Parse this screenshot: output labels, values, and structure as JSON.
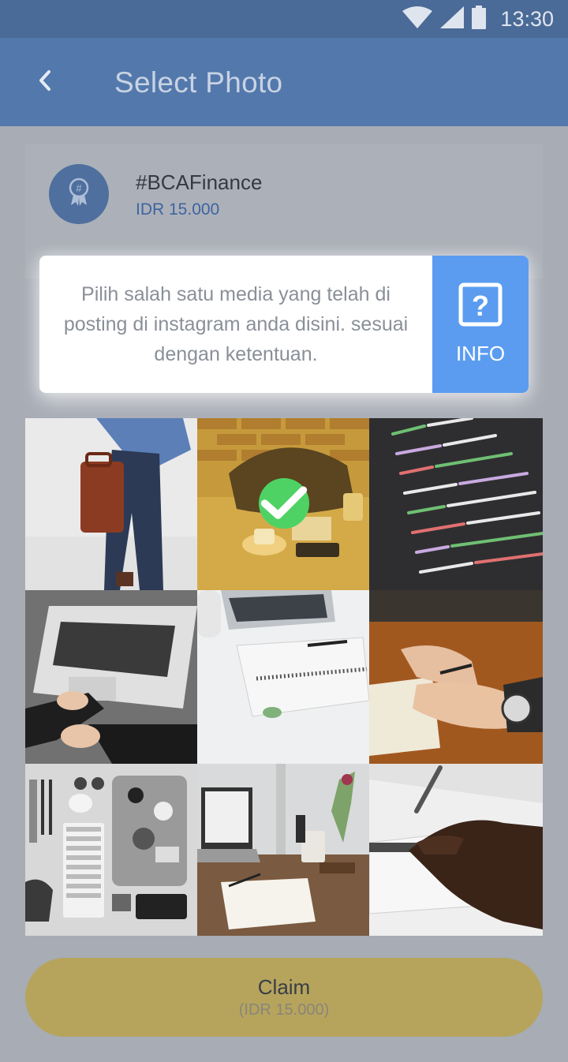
{
  "status_bar": {
    "time": "13:30",
    "icons": [
      "wifi-icon",
      "signal-icon",
      "battery-icon"
    ]
  },
  "header": {
    "title": "Select Photo",
    "back_icon": "chevron-left-icon"
  },
  "campaign": {
    "badge_icon": "hashtag-ribbon-icon",
    "hashtag": "#BCAFinance",
    "price": "IDR 15.000"
  },
  "info": {
    "text": "Pilih salah satu media yang telah di posting di instagram anda disini. sesuai dengan ketentuan.",
    "button_label": "INFO",
    "button_icon": "question-icon"
  },
  "photos": [
    {
      "id": "photo-1",
      "subject": "person-with-briefcase",
      "selected": false
    },
    {
      "id": "photo-2",
      "subject": "desk-with-bag-and-coffee",
      "selected": true
    },
    {
      "id": "photo-3",
      "subject": "code-on-screen",
      "selected": false
    },
    {
      "id": "photo-4",
      "subject": "laptop-on-rug",
      "selected": false
    },
    {
      "id": "photo-5",
      "subject": "notebook-and-laptop",
      "selected": false
    },
    {
      "id": "photo-6",
      "subject": "hand-writing-with-watch",
      "selected": false
    },
    {
      "id": "photo-7",
      "subject": "flatlay-keyboard-gadgets",
      "selected": false
    },
    {
      "id": "photo-8",
      "subject": "desk-with-laptop-and-flowers",
      "selected": false
    },
    {
      "id": "photo-9",
      "subject": "hand-writing-on-paper",
      "selected": false
    }
  ],
  "claim": {
    "label": "Claim",
    "amount": "(IDR 15.000)"
  },
  "colors": {
    "app_bar": "#5378ac",
    "status_bar": "#4a6a97",
    "info_button": "#5b9cf0",
    "claim_button": "#b6a45d",
    "check": "#4fd264"
  }
}
